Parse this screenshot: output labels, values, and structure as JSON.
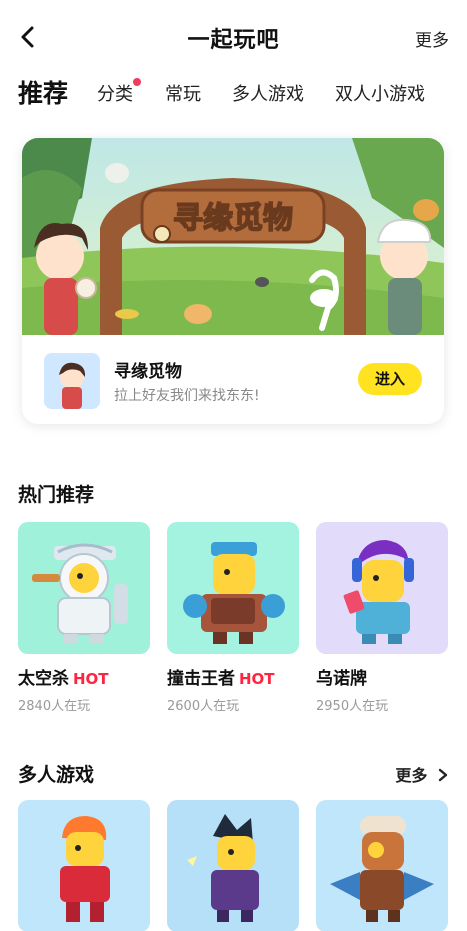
{
  "header": {
    "title": "一起玩吧",
    "more_label": "更多"
  },
  "tabs": [
    {
      "label": "推荐",
      "active": true
    },
    {
      "label": "分类",
      "badge_dot": true
    },
    {
      "label": "常玩"
    },
    {
      "label": "多人游戏"
    },
    {
      "label": "双人小游戏"
    }
  ],
  "featured": {
    "banner_title": "寻缘觅物",
    "name": "寻缘觅物",
    "description": "拉上好友我们来找东东!",
    "button_label": "进入"
  },
  "hot": {
    "title": "热门推荐",
    "games": [
      {
        "name": "太空杀",
        "badge": "HOT",
        "players": "2840人在玩",
        "bg": "#9ff1da"
      },
      {
        "name": "撞击王者",
        "badge": "HOT",
        "players": "2600人在玩",
        "bg": "#a3f3e0"
      },
      {
        "name": "乌诺牌",
        "badge": "",
        "players": "2950人在玩",
        "bg": "#e2dbfa"
      }
    ]
  },
  "multiplayer": {
    "title": "多人游戏",
    "more_label": "更多",
    "games": [
      {
        "bg": "#bfe6fb"
      },
      {
        "bg": "#b6e0f7"
      },
      {
        "bg": "#bfe6fb"
      }
    ]
  },
  "colors": {
    "accent_yellow": "#ffe321",
    "hot_red": "#ff2442",
    "badge_dot": "#ef3d5c"
  }
}
